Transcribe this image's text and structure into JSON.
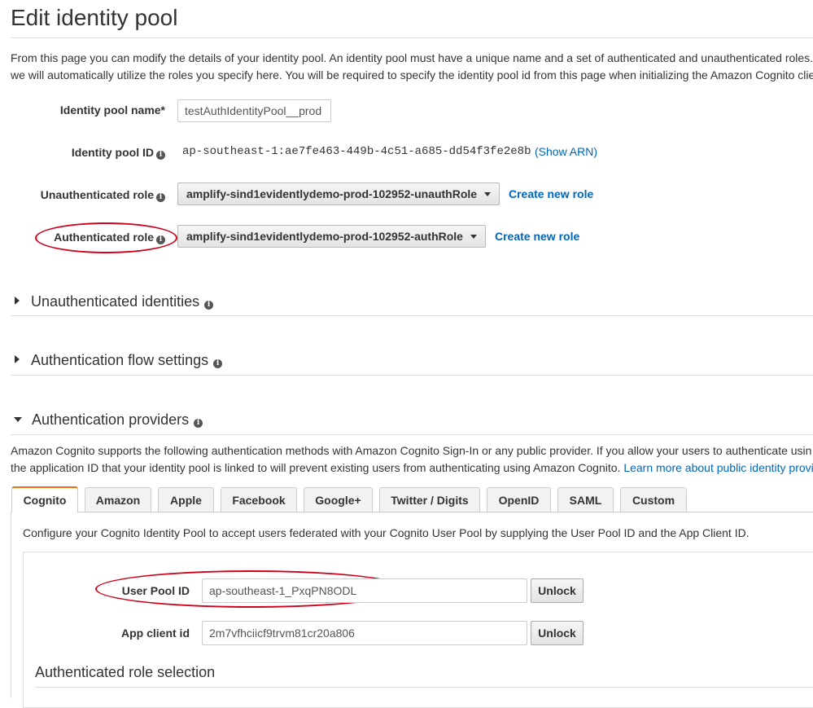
{
  "page": {
    "title": "Edit identity pool",
    "description_line1": "From this page you can modify the details of your identity pool. An identity pool must have a unique name and a set of authenticated and unauthenticated roles.",
    "description_line2": "we will automatically utilize the roles you specify here. You will be required to specify the identity pool id from this page when initializing the Amazon Cognito clie"
  },
  "form": {
    "pool_name_label": "Identity pool name*",
    "pool_name_value": "testAuthIdentityPool__prod",
    "pool_id_label": "Identity pool ID",
    "pool_id_value": "ap-southeast-1:ae7fe463-449b-4c51-a685-dd54f3fe2e8b",
    "show_arn_label": "(Show ARN)",
    "unauth_role_label": "Unauthenticated role",
    "unauth_role_value": "amplify-sind1evidentlydemo-prod-102952-unauthRole",
    "auth_role_label": "Authenticated role",
    "auth_role_value": "amplify-sind1evidentlydemo-prod-102952-authRole",
    "create_new_role_label": "Create new role"
  },
  "sections": {
    "unauth_identities": "Unauthenticated identities",
    "auth_flow": "Authentication flow settings",
    "auth_providers": "Authentication providers"
  },
  "providers": {
    "desc_line1": "Amazon Cognito supports the following authentication methods with Amazon Cognito Sign-In or any public provider. If you allow your users to authenticate usin",
    "desc_line2_text": "the application ID that your identity pool is linked to will prevent existing users from authenticating using Amazon Cognito.",
    "desc_line2_link": "Learn more about public identity provi",
    "tabs": [
      "Cognito",
      "Amazon",
      "Apple",
      "Facebook",
      "Google+",
      "Twitter / Digits",
      "OpenID",
      "SAML",
      "Custom"
    ],
    "active_tab": "Cognito",
    "cognito_desc": "Configure your Cognito Identity Pool to accept users federated with your Cognito User Pool by supplying the User Pool ID and the App Client ID.",
    "user_pool_id_label": "User Pool ID",
    "user_pool_id_value": "ap-southeast-1_PxqPN8ODL",
    "app_client_id_label": "App client id",
    "app_client_id_value": "2m7vfhciicf9trvm81cr20a806",
    "unlock_label": "Unlock",
    "auth_role_selection": "Authenticated role selection"
  },
  "colors": {
    "link": "#0066bb",
    "annotation": "#d0021b",
    "active_tab_accent": "#ec7211",
    "text": "#333333"
  }
}
